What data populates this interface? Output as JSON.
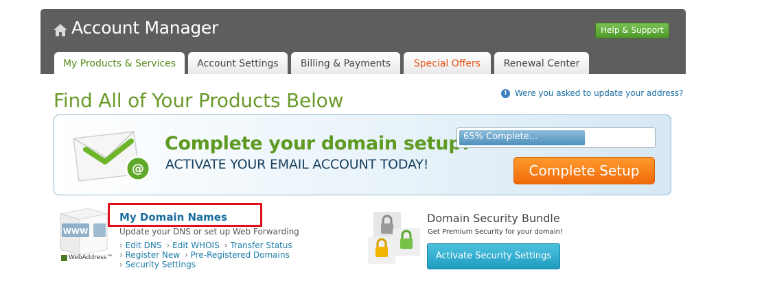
{
  "header": {
    "title": "Account Manager",
    "help_label": "Help & Support",
    "home_icon": "home-icon"
  },
  "tabs": [
    {
      "label": "My Products & Services",
      "active": true
    },
    {
      "label": "Account Settings"
    },
    {
      "label": "Billing & Payments"
    },
    {
      "label": "Special Offers",
      "highlight_color": "#e25315"
    },
    {
      "label": "Renewal Center"
    }
  ],
  "main": {
    "title": "Find All of Your Products Below",
    "address_link": "Were you asked to update your address?"
  },
  "banner": {
    "headline": "Complete your domain setup!",
    "subline": "ACTIVATE YOUR EMAIL ACCOUNT TODAY!",
    "progress_label": "65% Complete...",
    "progress_value": 0.65,
    "button_label": "Complete Setup",
    "icon": "email-envelope-icon"
  },
  "domains": {
    "title": "My Domain Names",
    "description": "Update your DNS or set up Web Forwarding",
    "brand": "WebAddress",
    "brand_tm": "™",
    "box_text": "WWW",
    "links_row1": [
      "Edit DNS",
      "Edit WHOIS",
      "Transfer Status"
    ],
    "links_row2": [
      "Register New",
      "Pre-Registered Domains"
    ],
    "links_row3": [
      "Security Settings"
    ]
  },
  "security": {
    "title": "Domain Security Bundle",
    "description": "Get Premium Security for your domain!",
    "button_label": "Activate Security Settings"
  },
  "colors": {
    "header_bg": "#5e5e5e",
    "accent_green": "#6a9a2a",
    "link_blue": "#1a6ea0",
    "orange": "#f06a0a",
    "highlight_red": "#e0101a"
  }
}
